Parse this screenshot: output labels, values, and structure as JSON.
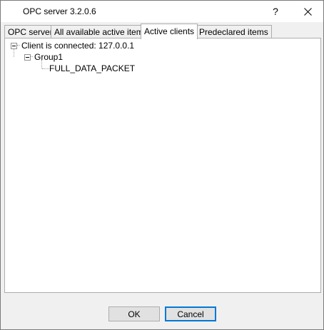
{
  "window": {
    "title": "OPC server 3.2.0.6",
    "help_label": "?",
    "close_icon": "close-icon"
  },
  "tabs": [
    {
      "label": "OPC server",
      "active": false
    },
    {
      "label": "All available active items",
      "active": false
    },
    {
      "label": "Active clients",
      "active": true
    },
    {
      "label": "Predeclared items",
      "active": false
    }
  ],
  "tree": {
    "client": "Client is connected: 127.0.0.1",
    "group": "Group1",
    "item": "FULL_DATA_PACKET"
  },
  "buttons": {
    "ok": "OK",
    "cancel": "Cancel"
  }
}
